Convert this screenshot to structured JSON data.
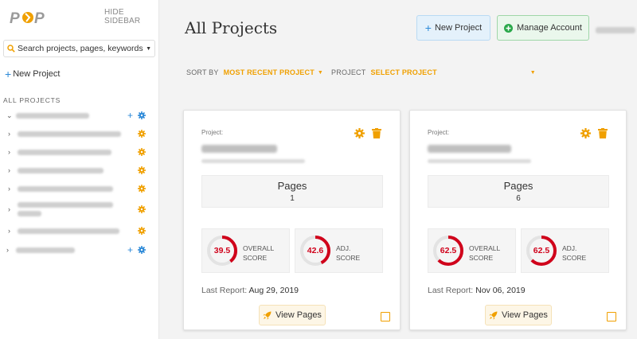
{
  "brand": {
    "logo_text": "POP",
    "accent": "#f0a000",
    "blue": "#2e8ad8",
    "red": "#d0021b"
  },
  "sidebar": {
    "hide_label": "HIDE SIDEBAR",
    "search_placeholder": "Search projects, pages, keywords...",
    "new_project_label": "New Project",
    "section_label": "ALL PROJECTS",
    "tree_icons": [
      "chevron-right-icon",
      "gear-icon",
      "plus-icon"
    ]
  },
  "header": {
    "title": "All Projects",
    "new_project_button": "New Project",
    "manage_account_button": "Manage Account"
  },
  "sortbar": {
    "sort_label": "SORT BY",
    "sort_value": "MOST RECENT PROJECT",
    "project_label": "PROJECT",
    "project_value": "SELECT PROJECT"
  },
  "cards": [
    {
      "project_label": "Project:",
      "pages_title": "Pages",
      "pages_count": "1",
      "overall": {
        "score": 39.5,
        "display": "39.5",
        "label1": "OVERALL",
        "label2": "SCORE"
      },
      "adj": {
        "score": 42.6,
        "display": "42.6",
        "label1": "ADJ.",
        "label2": "SCORE"
      },
      "last_report_label": "Last Report:",
      "last_report_date": "Aug 29, 2019",
      "view_button": "View Pages"
    },
    {
      "project_label": "Project:",
      "pages_title": "Pages",
      "pages_count": "6",
      "overall": {
        "score": 62.5,
        "display": "62.5",
        "label1": "OVERALL",
        "label2": "SCORE"
      },
      "adj": {
        "score": 62.5,
        "display": "62.5",
        "label1": "ADJ.",
        "label2": "SCORE"
      },
      "last_report_label": "Last Report:",
      "last_report_date": "Nov 06, 2019",
      "view_button": "View Pages"
    }
  ]
}
